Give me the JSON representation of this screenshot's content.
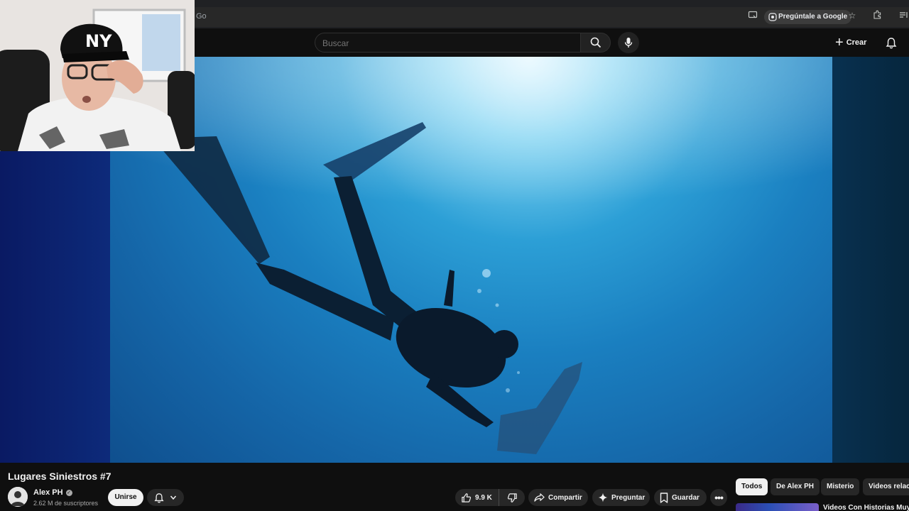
{
  "browser": {
    "address_text": "Go",
    "ask_google_label": "Pregúntale a Google"
  },
  "header": {
    "search_placeholder": "Buscar",
    "create_label": "Crear"
  },
  "video": {
    "title": "Lugares Siniestros #7"
  },
  "channel": {
    "name": "Alex PH",
    "subscribers": "2.62 M de suscriptores",
    "join_label": "Unirse"
  },
  "actions": {
    "likes": "9.9 K",
    "share_label": "Compartir",
    "ask_label": "Preguntar",
    "save_label": "Guardar"
  },
  "chips": [
    {
      "label": "Todos",
      "active": true
    },
    {
      "label": "De Alex PH",
      "active": false
    },
    {
      "label": "Misterio",
      "active": false
    },
    {
      "label": "Videos relac",
      "active": false
    }
  ],
  "recommendation": {
    "title": "Videos Con Historias Muy"
  },
  "icons": {
    "search": "search-icon",
    "mic": "mic-icon",
    "bell": "bell-icon",
    "like": "thumbs-up-icon",
    "dislike": "thumbs-down-icon",
    "share": "share-arrow-icon",
    "ask": "sparkle-icon",
    "save": "bookmark-icon",
    "more": "more-horizontal-icon"
  },
  "colors": {
    "background": "#0f0f0f",
    "pill": "#272727",
    "text": "#f1f1f1",
    "muted": "#aaaaaa"
  }
}
